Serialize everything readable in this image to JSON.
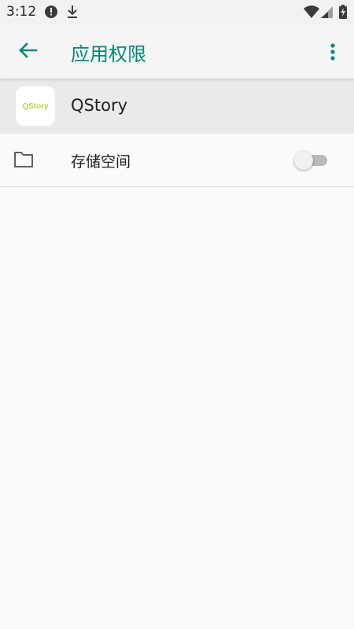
{
  "status_bar": {
    "time": "3:12",
    "left_icons": [
      "alert-icon",
      "download-icon"
    ],
    "right_icons": [
      "wifi-icon",
      "cellular-signal-icon",
      "battery-charging-icon"
    ]
  },
  "app_bar": {
    "title": "应用权限",
    "back_icon": "arrow-back-icon",
    "menu_icon": "more-vert-icon",
    "accent_color": "#00897b"
  },
  "app_info": {
    "icon_text": "QStory",
    "name": "QStory"
  },
  "permissions": [
    {
      "icon": "folder-icon",
      "label": "存储空间",
      "enabled": false
    }
  ]
}
